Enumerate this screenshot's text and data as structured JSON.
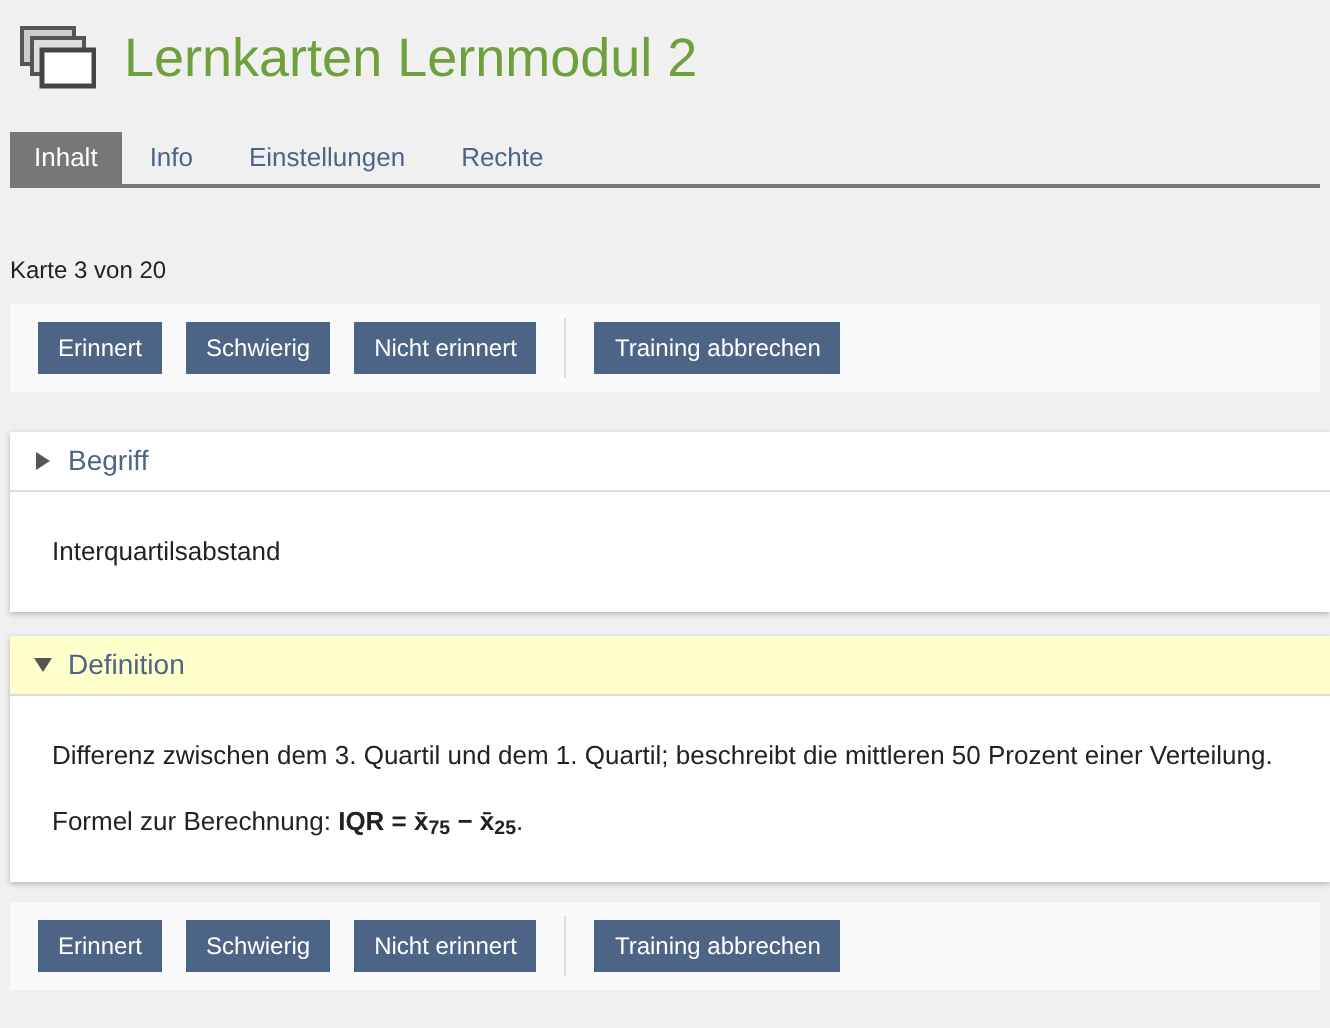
{
  "header": {
    "title": "Lernkarten Lernmodul 2"
  },
  "tabs": [
    {
      "label": "Inhalt",
      "selected": true
    },
    {
      "label": "Info",
      "selected": false
    },
    {
      "label": "Einstellungen",
      "selected": false
    },
    {
      "label": "Rechte",
      "selected": false
    }
  ],
  "card_counter": "Karte 3 von 20",
  "toolbar_top": {
    "answer_buttons": [
      "Erinnert",
      "Schwierig",
      "Nicht erinnert"
    ],
    "cancel_button": "Training abbrechen"
  },
  "panels": [
    {
      "title": "Begriff",
      "selected": false,
      "paragraphs": [
        "Interquartilsabstand"
      ]
    },
    {
      "title": "Definition",
      "selected": true,
      "paragraphs": [
        "Differenz zwischen dem 3. Quartil und dem 1. Quartil; beschreibt die mittleren 50 Prozent einer Verteilung.",
        "Formel zur Berechnung: **IQR = x̄$_{75}$ − x̄$_{25}$**."
      ]
    }
  ],
  "toolbar_bottom": {
    "answer_buttons": [
      "Erinnert",
      "Schwierig",
      "Nicht erinnert"
    ],
    "cancel_button": "Training abbrechen"
  }
}
